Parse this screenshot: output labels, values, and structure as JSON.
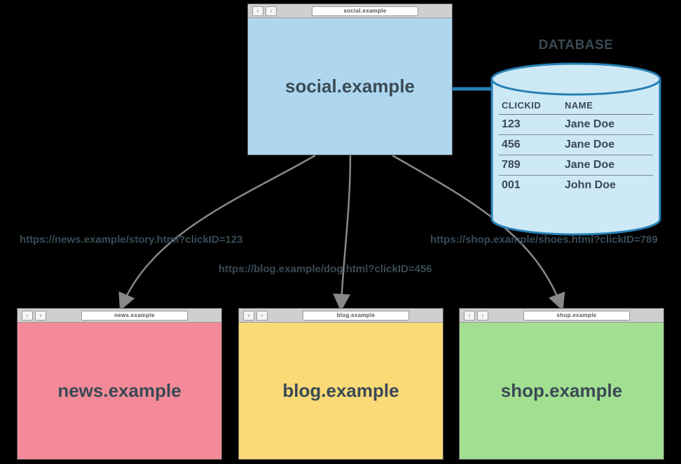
{
  "top_window": {
    "address": "social.example",
    "label": "social.example"
  },
  "bottom_windows": {
    "news": {
      "address": "news.example",
      "label": "news.example"
    },
    "blog": {
      "address": "blog.example",
      "label": "blog.example"
    },
    "shop": {
      "address": "shop.example",
      "label": "shop.example"
    }
  },
  "urls": {
    "left": "https://news.example/story.html?clickID=123",
    "mid": "https://blog.example/dog.html?clickID=456",
    "right": "https://shop.example/shoes.html?clickID=789"
  },
  "database": {
    "title": "DATABASE",
    "headers": {
      "c1": "CLICKID",
      "c2": "NAME"
    },
    "rows": [
      {
        "c1": "123",
        "c2": "Jane Doe"
      },
      {
        "c1": "456",
        "c2": "Jane Doe"
      },
      {
        "c1": "789",
        "c2": "Jane Doe"
      },
      {
        "c1": "001",
        "c2": "John Doe"
      }
    ]
  },
  "nav": {
    "back": "‹",
    "fwd": "›"
  }
}
